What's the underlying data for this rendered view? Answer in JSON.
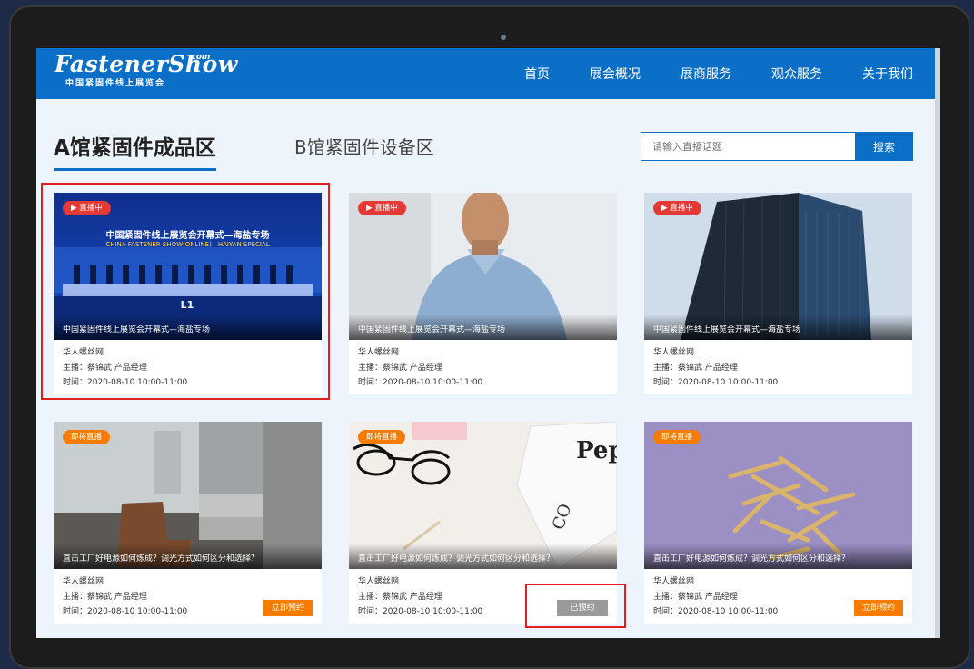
{
  "logo": {
    "main": "FastenerShow",
    "com": ".com",
    "sub": "中国紧固件线上展览会"
  },
  "nav": [
    "首页",
    "展会概况",
    "展商服务",
    "观众服务",
    "关于我们"
  ],
  "tabs": {
    "a": "A馆紧固件成品区",
    "b": "B馆紧固件设备区"
  },
  "search": {
    "placeholder": "请输入直播话题",
    "button": "搜索"
  },
  "banner": {
    "title": "中国紧固件线上展览会开幕式—海盐专场",
    "subtitle": "CHINA FASTENER SHOW(ONLINE)—HAIYAN SPECIAL"
  },
  "cards": [
    {
      "badge": "直播中",
      "title": "中国紧固件线上展览会开幕式—海盐专场",
      "company": "华人螺丝网",
      "host": "主播：蔡锦武 产品经理",
      "time": "时间：2020-08-10 10:00-11:00",
      "button": ""
    },
    {
      "badge": "直播中",
      "title": "中国紧固件线上展览会开幕式—海盐专场",
      "company": "华人螺丝网",
      "host": "主播：蔡锦武 产品经理",
      "time": "时间：2020-08-10 10:00-11:00",
      "button": ""
    },
    {
      "badge": "直播中",
      "title": "中国紧固件线上展览会开幕式—海盐专场",
      "company": "华人螺丝网",
      "host": "主播：蔡锦武 产品经理",
      "time": "时间：2020-08-10 10:00-11:00",
      "button": ""
    },
    {
      "badge": "即将直播",
      "title": "直击工厂好电源如何炼成？调光方式如何区分和选择？",
      "company": "华人螺丝网",
      "host": "主播：蔡锦武 产品经理",
      "time": "时间：2020-08-10 10:00-11:00",
      "button": "立即预约"
    },
    {
      "badge": "即将直播",
      "title": "直击工厂好电源如何炼成？调光方式如何区分和选择？",
      "company": "华人螺丝网",
      "host": "主播：蔡锦武 产品经理",
      "time": "时间：2020-08-10 10:00-11:00",
      "button": "已预约"
    },
    {
      "badge": "即将直播",
      "title": "直击工厂好电源如何炼成？调光方式如何区分和选择？",
      "company": "华人螺丝网",
      "host": "主播：蔡锦武 产品经理",
      "time": "时间：2020-08-10 10:00-11:00",
      "button": "立即预约"
    }
  ],
  "colors": {
    "brand": "#0c6fc7",
    "live": "#e53935",
    "soon": "#f57c00",
    "highlight": "#e02020",
    "booked": "#9a9a9a"
  },
  "icons": {
    "live_badge": "live-icon"
  }
}
